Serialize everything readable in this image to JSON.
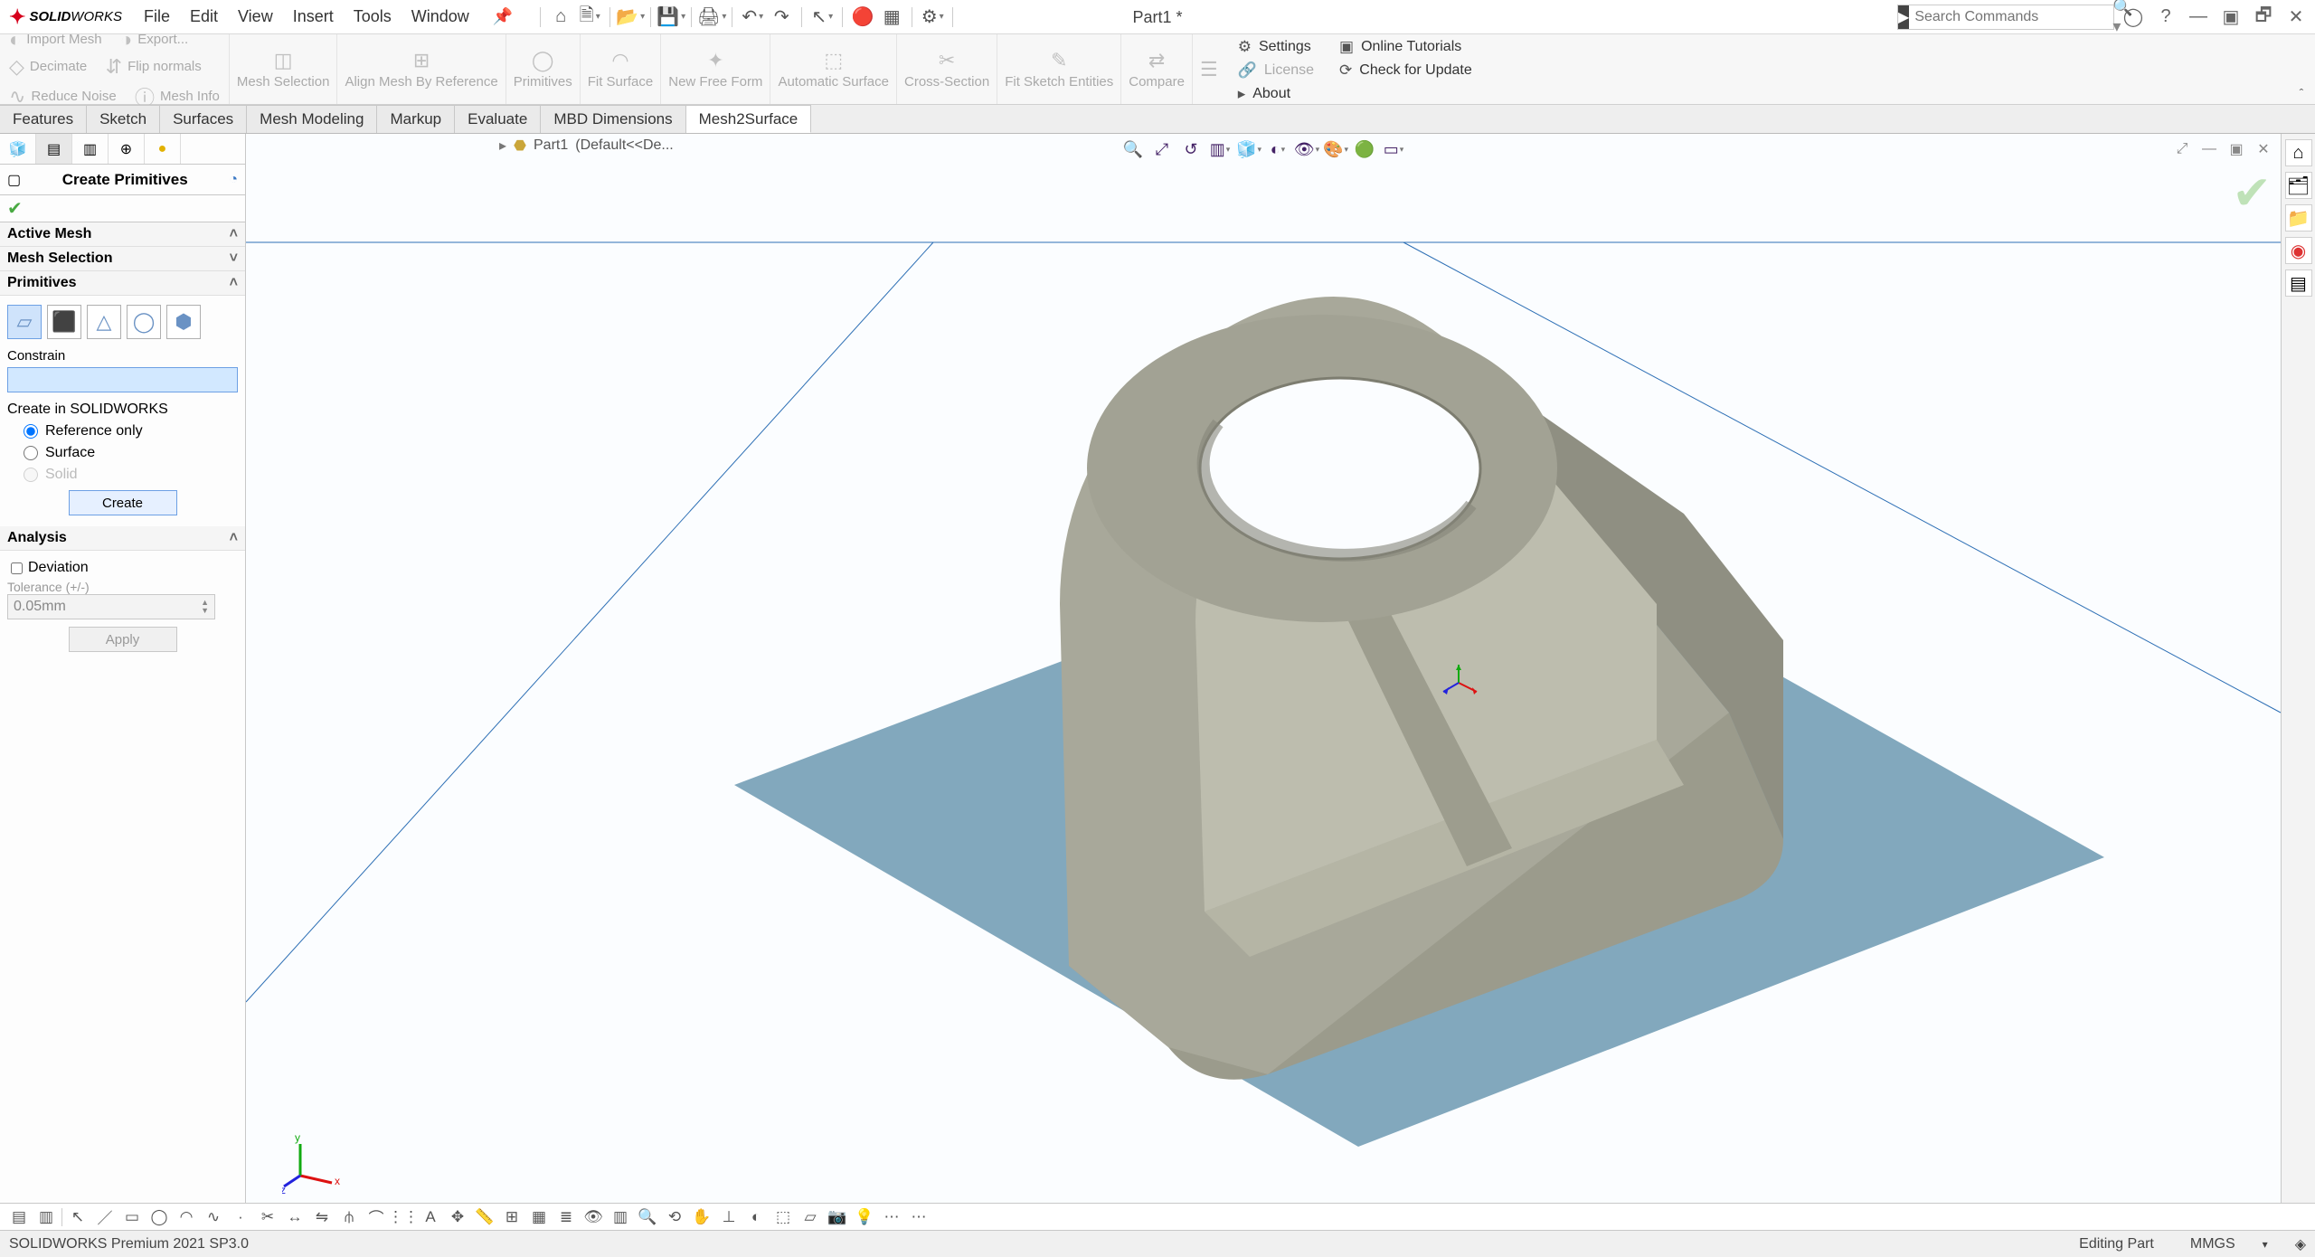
{
  "app": {
    "name_bold": "SOLID",
    "name_reg": "WORKS",
    "title": "Part1 *"
  },
  "menu": [
    "File",
    "Edit",
    "View",
    "Insert",
    "Tools",
    "Window"
  ],
  "search": {
    "placeholder": "Search Commands"
  },
  "ribbon": {
    "groups": [
      {
        "items": [
          "Import Mesh",
          "Export..."
        ],
        "items2": [
          "Decimate",
          "Flip normals"
        ],
        "items3": [
          "Reduce Noise",
          "Mesh Info"
        ]
      },
      {
        "label": "Mesh Selection"
      },
      {
        "label": "Align Mesh By Reference"
      },
      {
        "label": "Primitives"
      },
      {
        "label": "Fit Surface"
      },
      {
        "label": "New Free Form"
      },
      {
        "label": "Automatic Surface"
      },
      {
        "label": "Cross-Section"
      },
      {
        "label": "Fit Sketch Entities"
      },
      {
        "label": "Compare"
      }
    ],
    "settings": [
      {
        "icon": "⚙",
        "label": "Settings"
      },
      {
        "icon": "🔗",
        "label": "License"
      },
      {
        "icon": "▸",
        "label": "About"
      }
    ],
    "settings_right": [
      {
        "icon": "▣",
        "label": "Online Tutorials"
      },
      {
        "icon": "⟳",
        "label": "Check for Update"
      }
    ]
  },
  "cmd_tabs": [
    "Features",
    "Sketch",
    "Surfaces",
    "Mesh Modeling",
    "Markup",
    "Evaluate",
    "MBD Dimensions",
    "Mesh2Surface"
  ],
  "cmd_active": 7,
  "breadcrumb": {
    "item": "Part1",
    "suffix": "(Default<<De..."
  },
  "panel": {
    "title": "Create Primitives",
    "sect_active_mesh": "Active Mesh",
    "sect_mesh_sel": "Mesh Selection",
    "sect_primitives": "Primitives",
    "constrain": "Constrain",
    "create_in": "Create in SOLIDWORKS",
    "radios": [
      "Reference only",
      "Surface",
      "Solid"
    ],
    "create_btn": "Create",
    "sect_analysis": "Analysis",
    "deviation": "Deviation",
    "tolerance_lbl": "Tolerance (+/-)",
    "tolerance_val": "0.05mm",
    "apply_btn": "Apply"
  },
  "status": {
    "left": "SOLIDWORKS Premium 2021 SP3.0",
    "mid": "Editing Part",
    "units": "MMGS"
  }
}
